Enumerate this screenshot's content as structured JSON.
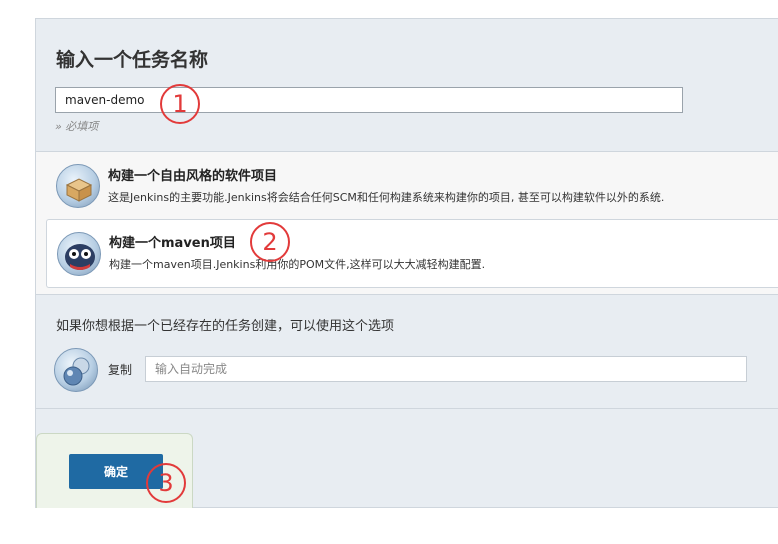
{
  "header": {
    "title": "输入一个任务名称"
  },
  "name_field": {
    "value": "maven-demo",
    "hint": "» 必填项"
  },
  "items": [
    {
      "title": "构建一个自由风格的软件项目",
      "description": "这是Jenkins的主要功能.Jenkins将会结合任何SCM和任何构建系统来构建你的项目, 甚至可以构建软件以外的系统.",
      "icon": "freestyle-box-icon"
    },
    {
      "title": "构建一个maven项目",
      "description": "构建一个maven项目.Jenkins利用你的POM文件,这样可以大大减轻构建配置.",
      "icon": "maven-owl-icon"
    }
  ],
  "copy": {
    "hint": "如果你想根据一个已经存在的任务创建，可以使用这个选项",
    "label": "复制",
    "placeholder": "输入自动完成",
    "icon": "copy-spheres-icon"
  },
  "ok_button": {
    "label": "确定"
  },
  "annotations": {
    "marker_1": "1",
    "marker_2": "2",
    "marker_3": "3"
  },
  "colors": {
    "button": "#1f6aa3",
    "marker": "#e23a3a",
    "panel": "#e8edf2"
  }
}
